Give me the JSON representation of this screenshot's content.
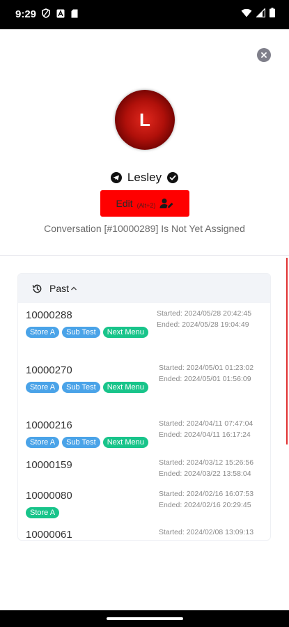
{
  "status_bar": {
    "time": "9:29"
  },
  "contact": {
    "initial": "L",
    "name": "Lesley"
  },
  "edit": {
    "label": "Edit",
    "shortcut": "(Alt+2)"
  },
  "conversation": {
    "status_text": "Conversation [#10000289] Is Not Yet Assigned"
  },
  "past_panel": {
    "title": "Past"
  },
  "conversations": [
    {
      "id": "10000288",
      "started": "Started: 2024/05/28 20:42:45",
      "ended": "Ended: 2024/05/28 19:04:49",
      "tags": [
        "Store A",
        "Sub Test",
        "Next Menu"
      ]
    },
    {
      "id": "10000270",
      "started": "Started: 2024/05/01 01:23:02",
      "ended": "Ended: 2024/05/01 01:56:09",
      "tags": [
        "Store A",
        "Sub Test",
        "Next Menu"
      ]
    },
    {
      "id": "10000216",
      "started": "Started: 2024/04/11 07:47:04",
      "ended": "Ended: 2024/04/11 16:17:24",
      "tags": [
        "Store A",
        "Sub Test",
        "Next Menu"
      ]
    },
    {
      "id": "10000159",
      "started": "Started: 2024/03/12 15:26:56",
      "ended": "Ended: 2024/03/22 13:58:04",
      "tags": []
    },
    {
      "id": "10000080",
      "started": "Started: 2024/02/16 16:07:53",
      "ended": "Ended: 2024/02/16 20:29:45",
      "tags": [
        "Store A"
      ]
    },
    {
      "id": "10000061",
      "started": "Started: 2024/02/08 13:09:13",
      "ended": "",
      "tags": []
    }
  ],
  "colors": {
    "edit_button": "#ff0000",
    "tag_blue": "#4aa3e8",
    "tag_green": "#18c48a"
  },
  "icons": {
    "close": "close-icon",
    "history": "history-icon",
    "chevron": "chevron-up-icon",
    "telegram": "telegram-icon",
    "verified": "verified-check-icon",
    "user_edit": "user-edit-icon"
  }
}
